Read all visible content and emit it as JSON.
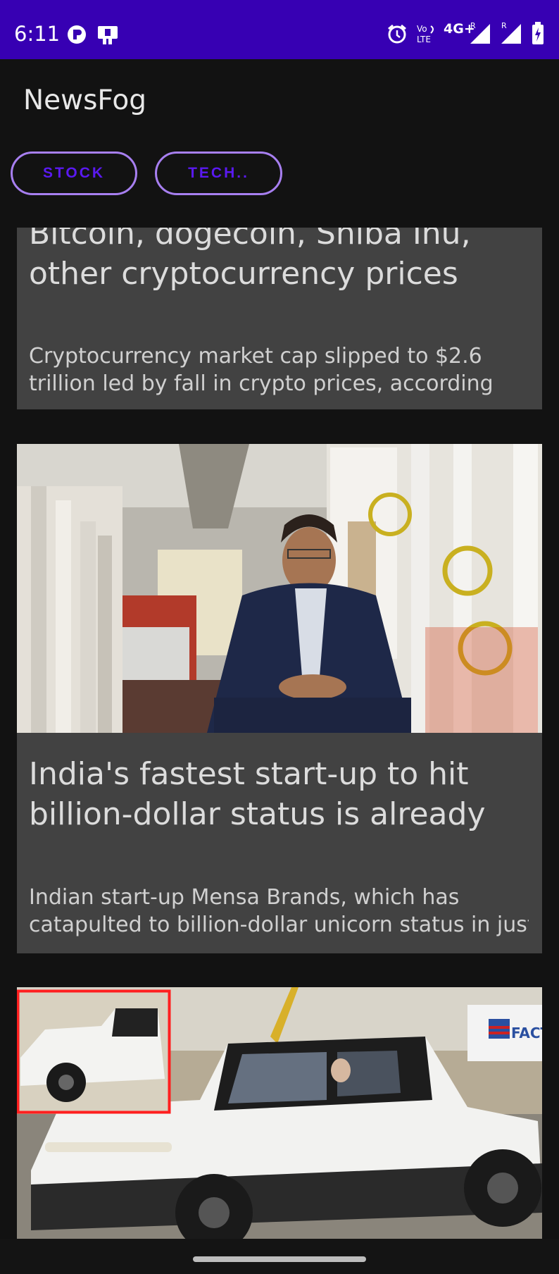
{
  "status_bar": {
    "time": "6:11",
    "network": "4G+"
  },
  "app": {
    "title": "NewsFog"
  },
  "chips": [
    {
      "label": "STOCK"
    },
    {
      "label": "TECH.."
    }
  ],
  "articles": [
    {
      "title_lines": [
        "Bitcoin, dogecoin, Shiba Inu,",
        "other cryptocurrency prices"
      ],
      "desc_lines": [
        "Cryptocurrency market cap slipped to $2.6",
        "trillion led by fall in crypto prices, according"
      ]
    },
    {
      "title_lines": [
        "India's fastest start-up to hit",
        "billion-dollar status is already"
      ],
      "desc_lines": [
        "Indian start-up Mensa Brands, which has",
        "catapulted to billion-dollar unicorn status in just"
      ]
    },
    {
      "image_sign": "FACTORY ZERO"
    }
  ],
  "colors": {
    "status_bar": "#3700b3",
    "chip_border": "#a77ff0",
    "chip_text": "#5a19f0",
    "card": "#424242",
    "background": "#121212"
  }
}
